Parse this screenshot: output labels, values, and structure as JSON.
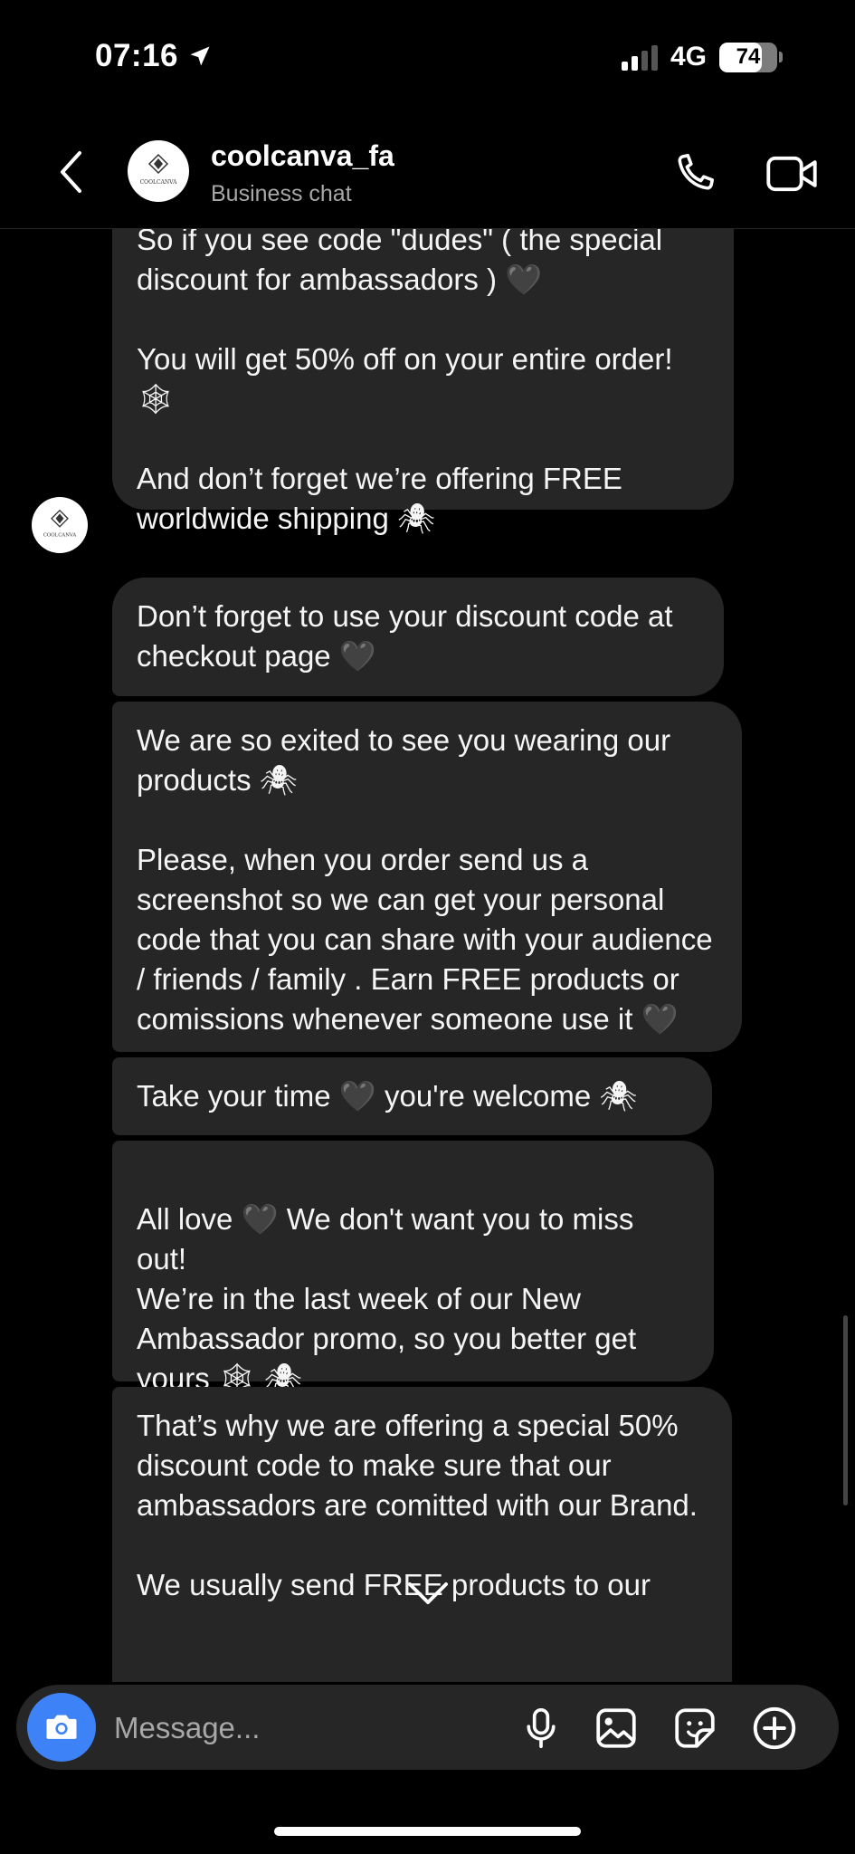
{
  "status_bar": {
    "time": "07:16",
    "network": "4G",
    "battery": "74",
    "battery_level": 0.74
  },
  "header": {
    "name": "coolcanva_fa",
    "subtitle": "Business chat",
    "avatar_text": "COOLCANVA"
  },
  "messages": [
    {
      "paras": [
        "So if you see code \"dudes\" ( the special discount for ambassadors ) 🖤",
        "You will get 50% off on your entire order! 🕸",
        "And don’t forget we’re offering FREE worldwide shipping 🕷"
      ]
    },
    {
      "paras": [
        "Don’t forget to use your discount code at checkout page 🖤"
      ]
    },
    {
      "paras": [
        "We are so exited to see you wearing our products 🕷",
        "Please, when you order send us a screenshot so we can get your personal code that you can share with your audience / friends / family . Earn FREE products or comissions whenever someone use it 🖤"
      ]
    },
    {
      "paras": [
        "Take your time 🖤 you're welcome 🕷"
      ]
    },
    {
      "paras": [
        "All love 🖤 We don't want you to miss out!\nWe’re in the last week of our New Ambassador promo, so you better get yours 🕸 🕷"
      ]
    },
    {
      "paras": [
        "That’s why we are offering a special 50% discount code to make sure that our ambassadors are comitted with our Brand.",
        "We usually send FREE products to our"
      ]
    }
  ],
  "composer": {
    "placeholder": "Message..."
  },
  "icons": {
    "back": "chevron-left-icon",
    "call": "phone-icon",
    "video": "video-camera-icon",
    "camera": "camera-icon",
    "mic": "microphone-icon",
    "gallery": "image-icon",
    "sticker": "sticker-icon",
    "more": "plus-circle-icon",
    "scroll": "chevron-down-icon"
  },
  "colors": {
    "background": "#000000",
    "bubble": "#262626",
    "camera_button": "#3d82f6",
    "secondary_text": "#a8a8a8"
  }
}
